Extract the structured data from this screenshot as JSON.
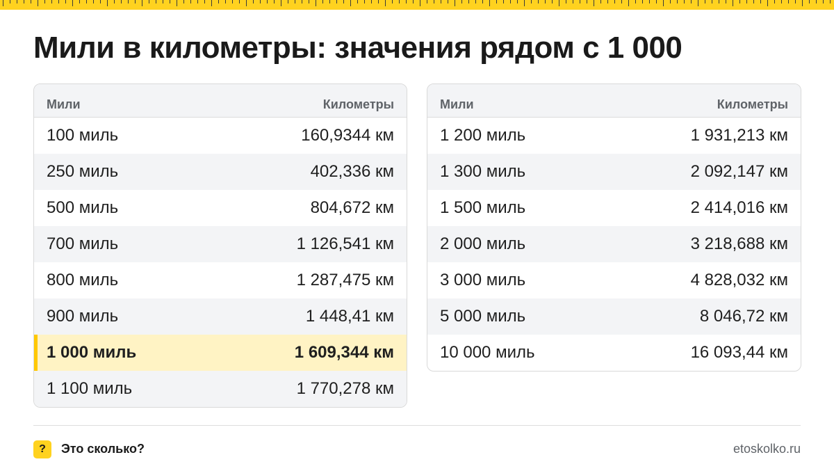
{
  "title": "Мили в километры: значения рядом с 1 000",
  "tables": [
    {
      "headers": {
        "miles": "Мили",
        "km": "Километры"
      },
      "rows": [
        {
          "miles": "100 миль",
          "km": "160,9344 км"
        },
        {
          "miles": "250 миль",
          "km": "402,336 км"
        },
        {
          "miles": "500 миль",
          "km": "804,672 км"
        },
        {
          "miles": "700 миль",
          "km": "1 126,541 км"
        },
        {
          "miles": "800 миль",
          "km": "1 287,475 км"
        },
        {
          "miles": "900 миль",
          "km": "1 448,41 км"
        },
        {
          "miles": "1 000 миль",
          "km": "1 609,344 км"
        },
        {
          "miles": "1 100 миль",
          "km": "1 770,278 км"
        }
      ]
    },
    {
      "headers": {
        "miles": "Мили",
        "km": "Километры"
      },
      "rows": [
        {
          "miles": "1 200 миль",
          "km": "1 931,213 км"
        },
        {
          "miles": "1 300 миль",
          "km": "2 092,147 км"
        },
        {
          "miles": "1 500 миль",
          "km": "2 414,016 км"
        },
        {
          "miles": "2 000 миль",
          "km": "3 218,688 км"
        },
        {
          "miles": "3 000 миль",
          "km": "4 828,032 км"
        },
        {
          "miles": "5 000 миль",
          "km": "8 046,72 км"
        },
        {
          "miles": "10 000 миль",
          "km": "16 093,44 км"
        }
      ]
    }
  ],
  "highlight_row": "1 000 миль",
  "footer": {
    "badge": "?",
    "brand": "Это сколько?",
    "site": "etoskolko.ru"
  },
  "colors": {
    "accent": "#ffd21f",
    "highlight_bg": "#fff3c4",
    "header_bg": "#f3f4f6"
  }
}
